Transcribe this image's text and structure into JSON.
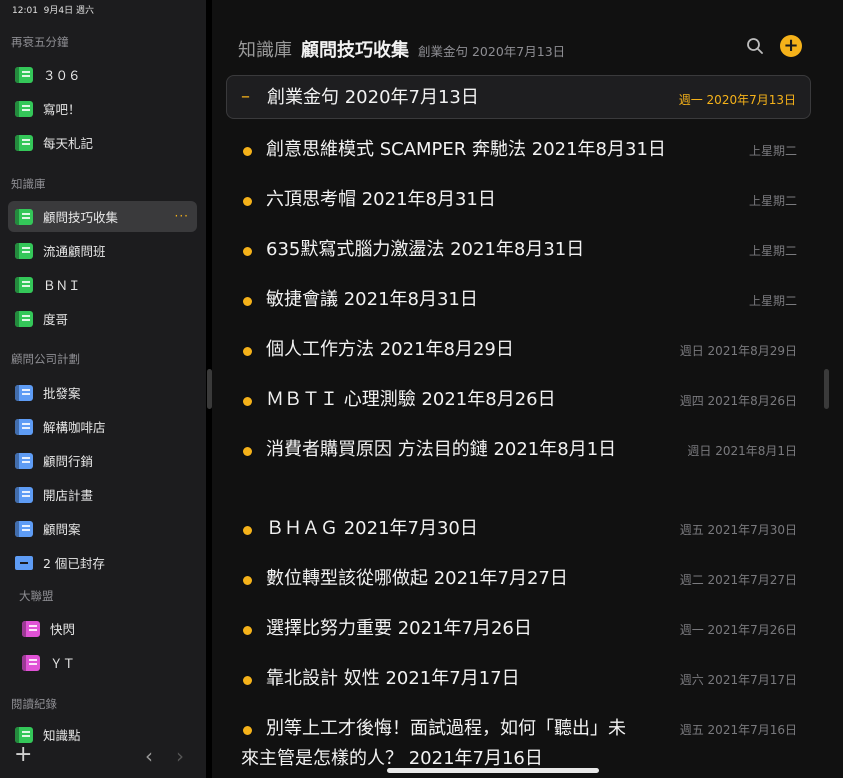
{
  "status_bar": {
    "time": "12:01",
    "date": "9月4日 週六"
  },
  "sidebar": {
    "sections": [
      {
        "title": "再衰五分鐘",
        "items": [
          {
            "label": "３０６",
            "color": "green"
          },
          {
            "label": "寫吧！",
            "color": "green"
          },
          {
            "label": "每天札記",
            "color": "green"
          }
        ]
      },
      {
        "title": "知識庫",
        "items": [
          {
            "label": "顧問技巧收集",
            "color": "green",
            "selected": true,
            "more": "···"
          },
          {
            "label": "流通顧問班",
            "color": "green"
          },
          {
            "label": "ＢＮＩ",
            "color": "green"
          },
          {
            "label": "度哥",
            "color": "green"
          }
        ]
      },
      {
        "title": "顧問公司計劃",
        "items": [
          {
            "label": "批發案",
            "color": "blue"
          },
          {
            "label": "解構咖啡店",
            "color": "blue"
          },
          {
            "label": "顧問行銷",
            "color": "blue"
          },
          {
            "label": "開店計畫",
            "color": "blue"
          },
          {
            "label": "顧問案",
            "color": "blue"
          },
          {
            "label": "2 個已封存",
            "icon": "archive-icon"
          }
        ]
      },
      {
        "title": "大聯盟",
        "items": [
          {
            "label": "快閃",
            "color": "pink"
          },
          {
            "label": "ＹＴ",
            "color": "pink"
          }
        ]
      },
      {
        "title": "閱讀紀錄",
        "items": [
          {
            "label": "知識點",
            "color": "green"
          }
        ]
      }
    ],
    "bottom": {
      "add": "+",
      "back": "‹",
      "forward": "›"
    }
  },
  "header": {
    "library": "知識庫",
    "notebook": "顧問技巧收集",
    "subtitle": "創業金句 2020年7月13日"
  },
  "colors": {
    "accent": "#f5b21a",
    "green": "#34c759",
    "blue": "#5e9cf5",
    "pink": "#e052d6"
  },
  "notes": [
    {
      "title": "創業金句 2020年7月13日",
      "date": "週一 2020年7月13日",
      "current": true
    },
    {
      "title": "創意思維模式 SCAMPER 奔馳法  2021年8月31日",
      "date": "上星期二"
    },
    {
      "title": "六頂思考帽 2021年8月31日",
      "date": "上星期二"
    },
    {
      "title": "635默寫式腦力激盪法  2021年8月31日",
      "date": "上星期二"
    },
    {
      "title": "敏捷會議 2021年8月31日",
      "date": "上星期二"
    },
    {
      "title": "個人工作方法 2021年8月29日",
      "date": "週日 2021年8月29日"
    },
    {
      "title": "ＭＢＴＩ 心理測驗 2021年8月26日",
      "date": "週四 2021年8月26日"
    },
    {
      "title": "消費者購買原因 方法目的鏈 2021年8月1日",
      "date": "週日 2021年8月1日"
    },
    {
      "title": "ＢＨＡＧ 2021年7月30日",
      "date": "週五 2021年7月30日"
    },
    {
      "title": "數位轉型該從哪做起 2021年7月27日",
      "date": "週二 2021年7月27日"
    },
    {
      "title": "選擇比努力重要 2021年7月26日",
      "date": "週一 2021年7月26日"
    },
    {
      "title": "靠北設計 奴性 2021年7月17日",
      "date": "週六 2021年7月17日"
    },
    {
      "title": "別等上工才後悔！面試過程，如何「聽出」未來主管是怎樣的人？ 2021年7月16日",
      "date": "週五 2021年7月16日"
    }
  ]
}
